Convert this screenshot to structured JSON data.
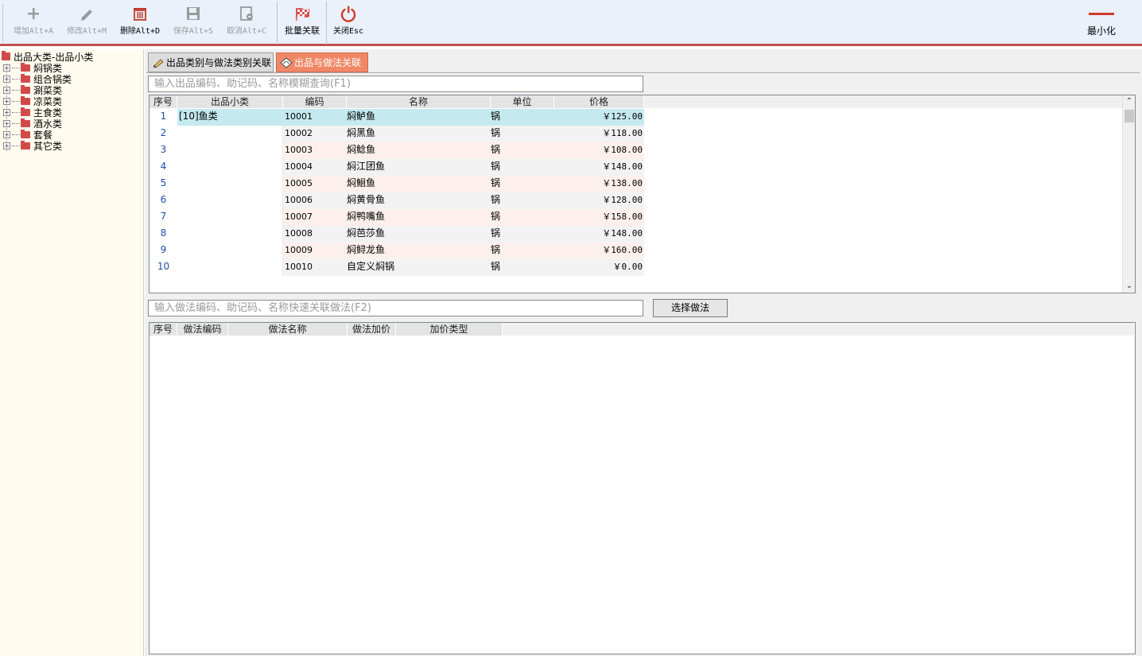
{
  "toolbar": {
    "buttons": [
      {
        "label": "增加Alt+A",
        "icon": "plus-icon",
        "enabled": false
      },
      {
        "label": "修改Alt+M",
        "icon": "pencil-icon",
        "enabled": false
      },
      {
        "label": "删除Alt+D",
        "icon": "trash-icon",
        "enabled": true
      },
      {
        "label": "保存Alt+S",
        "icon": "save-icon",
        "enabled": false
      },
      {
        "label": "取消Alt+C",
        "icon": "cancel-icon",
        "enabled": false
      },
      {
        "label": "批量关联",
        "icon": "checkered-flag-icon",
        "enabled": true
      },
      {
        "label": "关闭Esc",
        "icon": "power-icon",
        "enabled": true
      }
    ],
    "minimize_label": "最小化",
    "accent_color": "#c0504d"
  },
  "tree": {
    "root_label": "出品大类-出品小类",
    "items": [
      "焖锅类",
      "组合锅类",
      "涮菜类",
      "凉菜类",
      "主食类",
      "酒水类",
      "套餐",
      "其它类"
    ]
  },
  "tabs": [
    {
      "label": "出品类别与做法类别关联",
      "active": false
    },
    {
      "label": "出品与做法关联",
      "active": true
    }
  ],
  "product_search": {
    "placeholder": "输入出品编码、助记码、名称模糊查询(F1)"
  },
  "product_grid": {
    "columns": [
      "序号",
      "出品小类",
      "编码",
      "名称",
      "单位",
      "价格"
    ],
    "category": "[10]鱼类",
    "rows": [
      {
        "seq": "1",
        "code": "10001",
        "name": "焖鲈鱼",
        "unit": "锅",
        "price": "￥125.00"
      },
      {
        "seq": "2",
        "code": "10002",
        "name": "焖黑鱼",
        "unit": "锅",
        "price": "￥118.00"
      },
      {
        "seq": "3",
        "code": "10003",
        "name": "焖鲶鱼",
        "unit": "锅",
        "price": "￥108.00"
      },
      {
        "seq": "4",
        "code": "10004",
        "name": "焖江团鱼",
        "unit": "锅",
        "price": "￥148.00"
      },
      {
        "seq": "5",
        "code": "10005",
        "name": "焖鮰鱼",
        "unit": "锅",
        "price": "￥138.00"
      },
      {
        "seq": "6",
        "code": "10006",
        "name": "焖黄骨鱼",
        "unit": "锅",
        "price": "￥128.00"
      },
      {
        "seq": "7",
        "code": "10007",
        "name": "焖鸭嘴鱼",
        "unit": "锅",
        "price": "￥158.00"
      },
      {
        "seq": "8",
        "code": "10008",
        "name": "焖芭莎鱼",
        "unit": "锅",
        "price": "￥148.00"
      },
      {
        "seq": "9",
        "code": "10009",
        "name": "焖鲟龙鱼",
        "unit": "锅",
        "price": "￥160.00"
      },
      {
        "seq": "10",
        "code": "10010",
        "name": "自定义焖锅",
        "unit": "锅",
        "price": "￥0.00"
      }
    ]
  },
  "method_search": {
    "placeholder": "输入做法编码、助记码、名称快速关联做法(F2)"
  },
  "select_method_button": "选择做法",
  "method_grid": {
    "columns": [
      "序号",
      "做法编码",
      "做法名称",
      "做法加价",
      "加价类型"
    ]
  }
}
